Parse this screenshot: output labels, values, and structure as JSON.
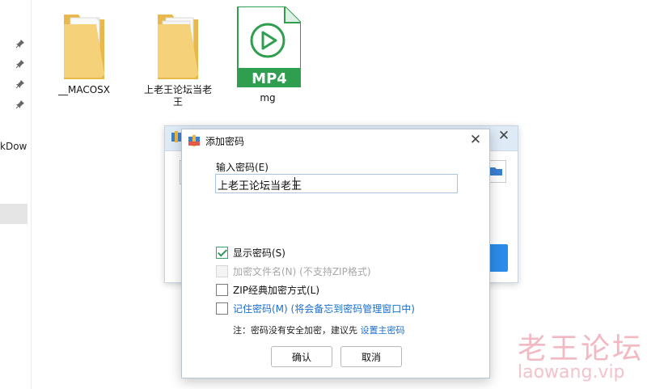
{
  "sidebar": {
    "partial_text": "kDow"
  },
  "files": [
    {
      "name": "__MACOSX",
      "icon": "folder-icon"
    },
    {
      "name": "上老王论坛当老\n王",
      "icon": "folder-icon"
    },
    {
      "name": "mg",
      "icon": "mp4-file-icon",
      "badge": "MP4"
    }
  ],
  "dialog": {
    "title": "添加密码",
    "password_label": "输入密码(E)",
    "password_value": "上老王论坛当老王",
    "options": [
      {
        "label": "显示密码(S)",
        "checked": true,
        "disabled": false
      },
      {
        "label": "加密文件名(N) (不支持ZIP格式)",
        "checked": false,
        "disabled": true
      },
      {
        "label": "ZIP经典加密方式(L)",
        "checked": false,
        "disabled": false
      },
      {
        "label": "记住密码(M) (将会备忘到密码管理窗口中)",
        "checked": false,
        "disabled": false,
        "link": true
      }
    ],
    "note_prefix": "注：密码没有安全加密，建议先 ",
    "note_link": "设置主密码",
    "ok_label": "确认",
    "cancel_label": "取消"
  },
  "watermark": {
    "cn": "老王论坛",
    "en": "laowang.vip"
  },
  "colors": {
    "accent_blue": "#2b8be8",
    "link": "#1a6fd1",
    "check_green": "#2c9a5d",
    "title_bar": "#dfeaf7"
  }
}
